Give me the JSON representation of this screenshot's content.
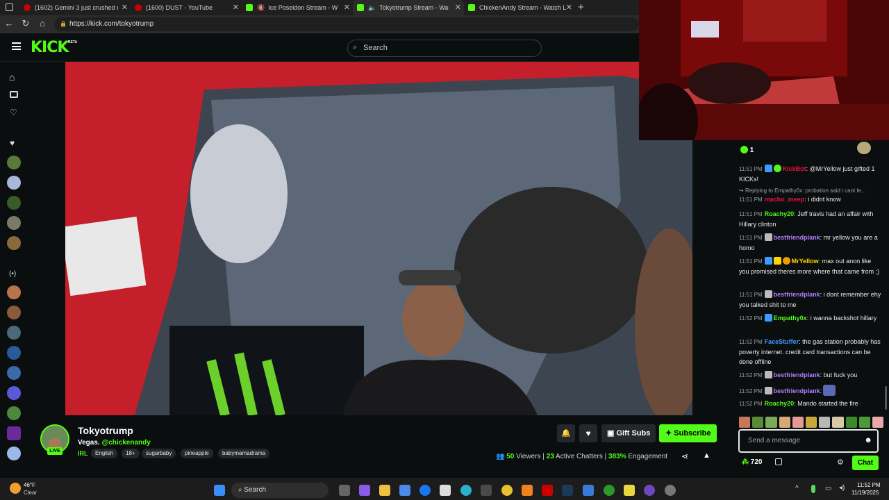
{
  "browser": {
    "tabs": [
      {
        "label": "(1602) Gemini 3 just crushed eve",
        "icon": "youtube-icon",
        "color": "#cc0000"
      },
      {
        "label": "(1600) DUST - YouTube",
        "icon": "youtube-icon",
        "color": "#cc0000"
      },
      {
        "label": "Ice Poseidon Stream - Watch",
        "icon": "kick-icon",
        "color": "#53fc18"
      },
      {
        "label": "Tokyotrump Stream - Watch",
        "icon": "kick-icon",
        "color": "#53fc18"
      },
      {
        "label": "ChickenAndy Stream - Watch Live",
        "icon": "kick-icon",
        "color": "#53fc18"
      }
    ],
    "url": "https://kick.com/tokyotrump"
  },
  "header": {
    "logo": "KICK",
    "beta": "BETA",
    "search_placeholder": "Search"
  },
  "stream": {
    "name": "Tokyotrump",
    "title_prefix": "Vegas.",
    "title_mention": "@chickenandy",
    "category": "IRL",
    "live_label": "LIVE",
    "tags": [
      "English",
      "18+",
      "sugarbaby",
      "pineapple",
      "babymamadrama"
    ],
    "gift_label": "Gift Subs",
    "subscribe_label": "Subscribe",
    "viewers_num": "50",
    "viewers_label": "Viewers",
    "chatters_num": "23",
    "chatters_label": "Active Chatters",
    "engagement_num": "383%",
    "engagement_label": "Engagement"
  },
  "chat": {
    "kick_count": "1",
    "reply_text": "Replying to Empathy0x: probation said i cant le...",
    "messages": [
      {
        "time": "11:51 PM",
        "user": "KickBot",
        "color": "#e9113c",
        "text": ": @MrYellow just gifted 1 KICKs!"
      },
      {
        "time": "11:51 PM",
        "user": "macho_meep",
        "color": "#e9113c",
        "text": ": i didnt know"
      },
      {
        "time": "11:51 PM",
        "user": "Roachy20",
        "color": "#53fc18",
        "text": ": Jeff travis had an affair with Hillary clinton"
      },
      {
        "time": "11:51 PM",
        "user": "bestfriendplank",
        "color": "#b57dff",
        "text": ": mr yellow you are a homo"
      },
      {
        "time": "11:51 PM",
        "user": "MrYellow",
        "color": "#ffd400",
        "text": ": max out anon like you promised theres more where that came from ;)"
      },
      {
        "time": "11:51 PM",
        "user": "bestfriendplank",
        "color": "#b57dff",
        "text": ": i dont remember ehy you talked shit to me"
      },
      {
        "time": "11:52 PM",
        "user": "Empathy0x",
        "color": "#53fc18",
        "text": ": i wanna backshot hillary"
      },
      {
        "time": "11:52 PM",
        "user": "FaceStuffer",
        "color": "#3d9bff",
        "text": ": the gas station probably has poverty internet. credit card transactions can be done offline"
      },
      {
        "time": "11:52 PM",
        "user": "bestfriendplank",
        "color": "#b57dff",
        "text": ": but fuck you"
      },
      {
        "time": "11:52 PM",
        "user": "bestfriendplank",
        "color": "#b57dff",
        "text": ":"
      },
      {
        "time": "11:52 PM",
        "user": "Roachy20",
        "color": "#53fc18",
        "text": ": Mando started the fire"
      }
    ],
    "input_placeholder": "Send a message",
    "points": "720",
    "chat_button": "Chat"
  },
  "taskbar": {
    "weather_temp": "46°F",
    "weather_desc": "Clear",
    "search_label": "Search",
    "time": "11:52 PM",
    "date": "11/19/2025"
  }
}
